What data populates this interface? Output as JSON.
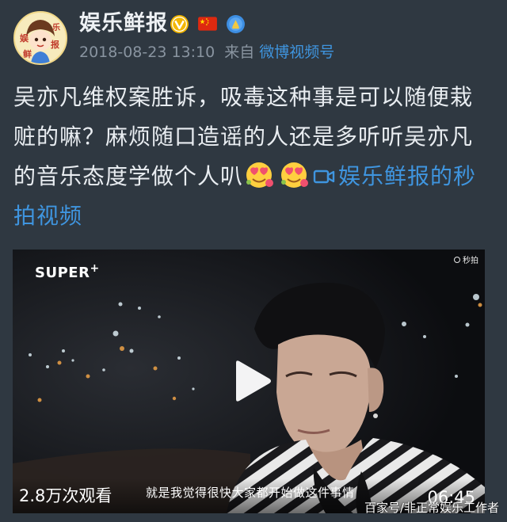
{
  "account": {
    "name": "娱乐鲜报",
    "avatar_text": [
      "娱",
      "乐",
      "鲜",
      "报"
    ]
  },
  "badges": {
    "verified_icon": "verified-v-icon",
    "flag_icon": "china-flag-icon",
    "medal_icon": "medal-icon",
    "verified_color": "#f2b600"
  },
  "meta": {
    "timestamp": "2018-08-23 13:10",
    "source_prefix": "来自",
    "source_link": "微博视频号"
  },
  "post": {
    "text": "吴亦凡维权案胜诉，吸毒这种事是可以随便栽赃的嘛？麻烦随口造谣的人还是多听听吴亦凡的音乐态度学做个人叭",
    "emoji_icons": [
      "heart-eyes-emoji-icon",
      "heart-eyes-emoji-icon"
    ],
    "video_link_label": "娱乐鲜报的秒拍视频",
    "link_color": "#3f95df"
  },
  "video": {
    "brand": "SUPER",
    "brand_sup": "+",
    "watermark": "秒拍",
    "views": "2.8万次观看",
    "subtitle": "就是我觉得很快大家都开始做这件事情",
    "duration": "06:45"
  },
  "footer": {
    "watermark": "百家号/非正常娱乐工作者"
  }
}
